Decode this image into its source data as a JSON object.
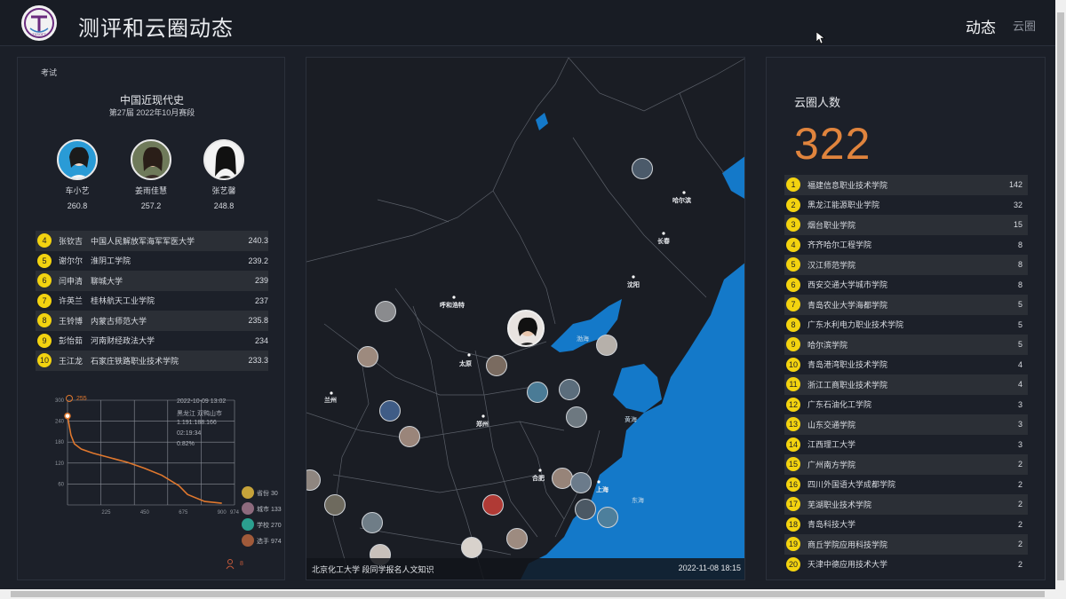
{
  "header": {
    "logo_text": "TXSOFT",
    "title": "测评和云圈动态",
    "nav_active": "动态",
    "nav_item": "云圈"
  },
  "exam": {
    "label": "考试",
    "title": "中国近现代史",
    "subtitle": "第27届 2022年10月赛段",
    "podium": [
      {
        "name": "车小艺",
        "score": "260.8"
      },
      {
        "name": "姜雨佳慧",
        "score": "257.2"
      },
      {
        "name": "张艺馨",
        "score": "248.8"
      }
    ],
    "ranks": [
      {
        "n": "4",
        "name": "张钦吉",
        "school": "中国人民解放军海军军医大学",
        "score": "240.3"
      },
      {
        "n": "5",
        "name": "谢尔尔",
        "school": "淮阴工学院",
        "score": "239.2"
      },
      {
        "n": "6",
        "name": "闫申清",
        "school": "聊城大学",
        "score": "239"
      },
      {
        "n": "7",
        "name": "许英兰",
        "school": "桂林航天工业学院",
        "score": "237"
      },
      {
        "n": "8",
        "name": "王铃博",
        "school": "内蒙古师范大学",
        "score": "235.8"
      },
      {
        "n": "9",
        "name": "彭怡茹",
        "school": "河南财经政法大学",
        "score": "234"
      },
      {
        "n": "10",
        "name": "王江龙",
        "school": "石家庄铁路职业技术学院",
        "score": "233.3"
      }
    ]
  },
  "chart_data": {
    "type": "line",
    "title": "",
    "marker_label": "255",
    "x_ticks": [
      "225",
      "450",
      "675",
      "900",
      "974"
    ],
    "y_ticks": [
      "60",
      "120",
      "180",
      "240",
      "300"
    ],
    "x": [
      0,
      20,
      40,
      80,
      150,
      250,
      350,
      450,
      550,
      650,
      700,
      800,
      900
    ],
    "y": [
      255,
      200,
      175,
      160,
      148,
      135,
      122,
      105,
      85,
      55,
      30,
      10,
      5
    ],
    "xlim": [
      0,
      974
    ],
    "ylim": [
      0,
      300
    ],
    "series_color": "#e0782e"
  },
  "stats": {
    "time": "2022-10-09 13:02",
    "location": "黑龙江 双鸭山市",
    "ip": "1.191.188.166",
    "duration": "02:19:34",
    "percent": "0.82%",
    "provinces_label": "省份 30",
    "cities_label": "城市 133",
    "schools_label": "学校 270",
    "players_label": "选手 974",
    "person_count": "8"
  },
  "map": {
    "cities": [
      "哈尔滨",
      "长春",
      "沈阳",
      "呼和浩特",
      "太原",
      "兰州",
      "郑州",
      "合肥",
      "上海"
    ],
    "seas": [
      "渤海",
      "黄海",
      "东海"
    ],
    "footer_left": "北京化工大学 段同学报名人文知识",
    "footer_right": "2022-11-08 18:15"
  },
  "cloud": {
    "title": "云圈人数",
    "count": "322",
    "schools": [
      {
        "n": "1",
        "name": "福建信息职业技术学院",
        "v": "142"
      },
      {
        "n": "2",
        "name": "黑龙江能源职业学院",
        "v": "32"
      },
      {
        "n": "3",
        "name": "烟台职业学院",
        "v": "15"
      },
      {
        "n": "4",
        "name": "齐齐哈尔工程学院",
        "v": "8"
      },
      {
        "n": "5",
        "name": "汉江师范学院",
        "v": "8"
      },
      {
        "n": "6",
        "name": "西安交通大学城市学院",
        "v": "8"
      },
      {
        "n": "7",
        "name": "青岛农业大学海都学院",
        "v": "5"
      },
      {
        "n": "8",
        "name": "广东水利电力职业技术学院",
        "v": "5"
      },
      {
        "n": "9",
        "name": "哈尔滨学院",
        "v": "5"
      },
      {
        "n": "10",
        "name": "青岛港湾职业技术学院",
        "v": "4"
      },
      {
        "n": "11",
        "name": "浙江工商职业技术学院",
        "v": "4"
      },
      {
        "n": "12",
        "name": "广东石油化工学院",
        "v": "3"
      },
      {
        "n": "13",
        "name": "山东交通学院",
        "v": "3"
      },
      {
        "n": "14",
        "name": "江西理工大学",
        "v": "3"
      },
      {
        "n": "15",
        "name": "广州南方学院",
        "v": "2"
      },
      {
        "n": "16",
        "name": "四川外国语大学成都学院",
        "v": "2"
      },
      {
        "n": "17",
        "name": "芜湖职业技术学院",
        "v": "2"
      },
      {
        "n": "18",
        "name": "青岛科技大学",
        "v": "2"
      },
      {
        "n": "19",
        "name": "商丘学院应用科技学院",
        "v": "2"
      },
      {
        "n": "20",
        "name": "天津中德应用技术大学",
        "v": "2"
      }
    ]
  }
}
